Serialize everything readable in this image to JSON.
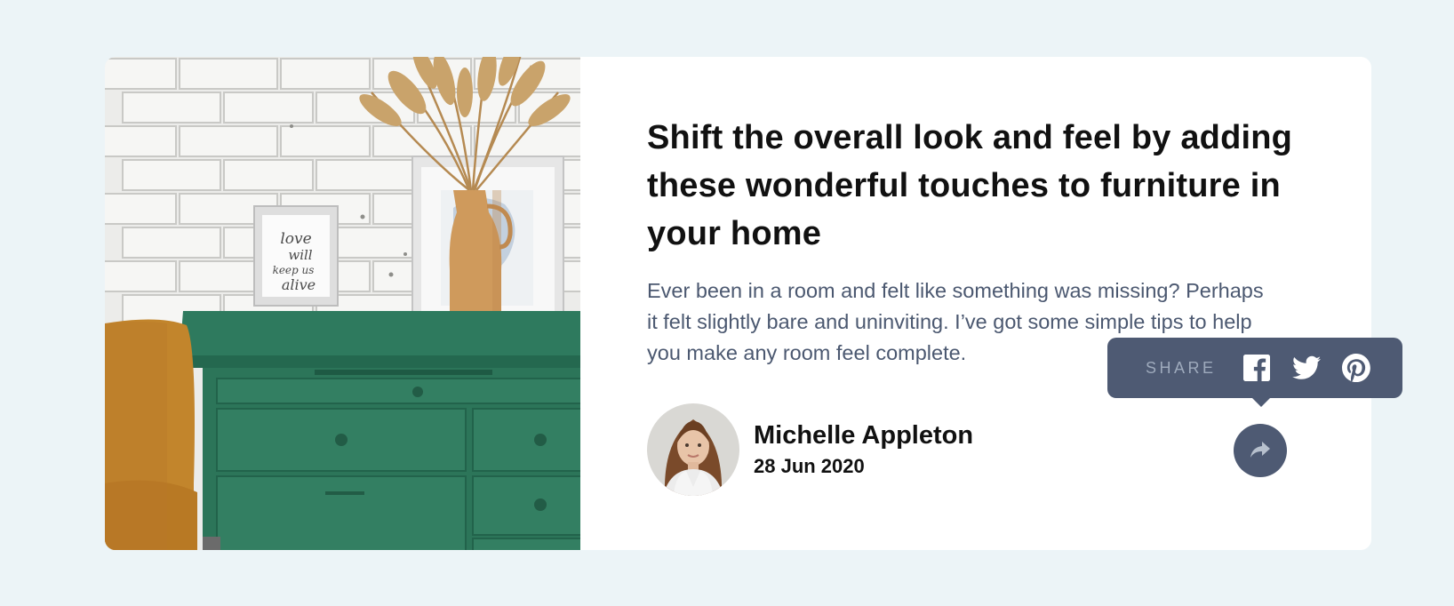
{
  "article": {
    "title": "Shift the overall look and feel by adding these wonderful touches to furniture in your home",
    "excerpt": "Ever been in a room and felt like something was missing? Perhaps it felt slightly bare and uninviting. I’ve got some simple tips to help you make any room feel complete.",
    "image_alt": "Green dresser with a vase of dried grass and framed prints"
  },
  "author": {
    "name": "Michelle Appleton",
    "date": "28 Jun 2020"
  },
  "share": {
    "label": "SHARE",
    "networks": [
      "facebook-icon",
      "twitter-icon",
      "pinterest-icon"
    ]
  },
  "frame_text": "love will keep us alive",
  "colors": {
    "background": "#ecf4f7",
    "card": "#ffffff",
    "title": "#111111",
    "body": "#4b5870",
    "share_bg": "#4e5a73",
    "share_label": "#9eaabc"
  }
}
